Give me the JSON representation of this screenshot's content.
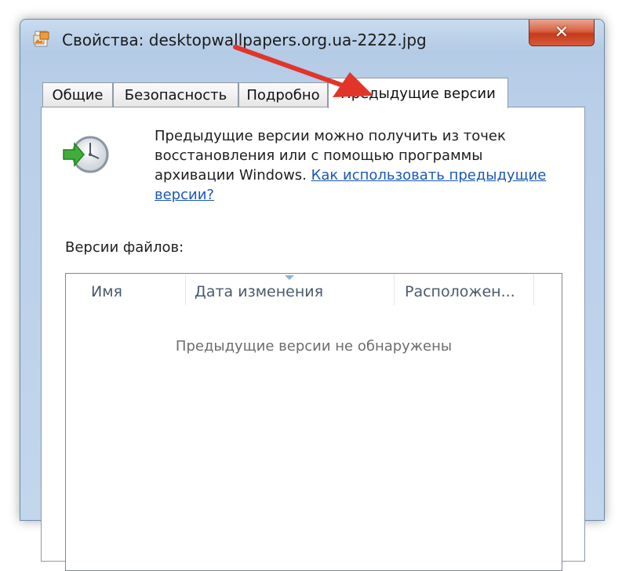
{
  "window": {
    "title": "Свойства: desktopwallpapers.org.ua-2222.jpg",
    "close_label": "✕"
  },
  "tabs": [
    {
      "label": "Общие",
      "active": false
    },
    {
      "label": "Безопасность",
      "active": false
    },
    {
      "label": "Подробно",
      "active": false
    },
    {
      "label": "Предыдущие версии",
      "active": true
    }
  ],
  "panel": {
    "info_text": "Предыдущие версии можно получить из точек восстановления или с помощью программы архивации Windows.",
    "help_link": "Как использовать предыдущие версии?",
    "versions_label": "Версии файлов:",
    "columns": [
      "Имя",
      "Дата изменения",
      "Расположен..."
    ],
    "empty_message": "Предыдущие версии не обнаружены"
  },
  "annotation": {
    "arrow_color": "#e2352a"
  },
  "colors": {
    "link": "#1a58b8",
    "close_button": "#c9472a"
  }
}
